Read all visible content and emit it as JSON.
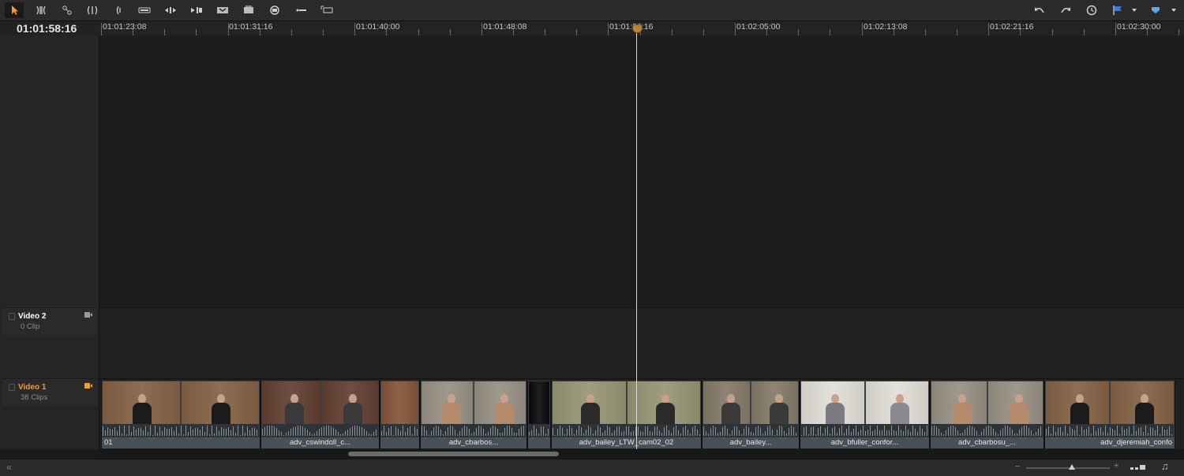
{
  "toolbar": {
    "tools": [
      {
        "name": "selection-mode",
        "icon": "arrow-pointer-icon",
        "active": true
      },
      {
        "name": "trim-edit-mode",
        "icon": "trim-icon"
      },
      {
        "name": "blade-edit-mode",
        "icon": "razor-icon"
      },
      {
        "name": "dynamic-trim-mode",
        "icon": "dynamic-trim-icon"
      },
      {
        "name": "snap-toggle",
        "icon": "bracket-icon"
      },
      {
        "name": "insert-clip",
        "icon": "insert-icon"
      },
      {
        "name": "overwrite-clip",
        "icon": "overwrite-icon"
      },
      {
        "name": "replace-clip",
        "icon": "replace-icon"
      },
      {
        "name": "fit-to-fill",
        "icon": "fit-to-fill-icon"
      },
      {
        "name": "place-on-top",
        "icon": "place-on-top-icon"
      },
      {
        "name": "ripple-overwrite",
        "icon": "ripple-icon"
      },
      {
        "name": "append-at-end",
        "icon": "append-icon"
      },
      {
        "name": "add-track",
        "icon": "add-track-icon"
      }
    ],
    "right_tools": [
      {
        "name": "undo",
        "icon": "undo-icon"
      },
      {
        "name": "redo",
        "icon": "redo-icon"
      },
      {
        "name": "history",
        "icon": "history-icon"
      },
      {
        "name": "flag",
        "icon": "flag-icon",
        "color": "#2f7de1"
      },
      {
        "name": "flag-dropdown",
        "icon": "chevron-down-icon"
      },
      {
        "name": "marker",
        "icon": "marker-icon",
        "color": "#5aa9f0"
      },
      {
        "name": "marker-dropdown",
        "icon": "chevron-down-icon"
      }
    ]
  },
  "timecode": "01:01:58:16",
  "ruler": {
    "labels": [
      "01:01:23:08",
      "01:01:31:16",
      "01:01:40:00",
      "01:01:48:08",
      "01:01:56:16",
      "01:02:05:00",
      "01:02:13:08",
      "01:02:21:16",
      "01:02:30:00"
    ]
  },
  "tracks": [
    {
      "name": "Video 2",
      "clips": "0 Clip",
      "active": false,
      "color": "#ffffff"
    },
    {
      "name": "Video 1",
      "clips": "38 Clips",
      "active": true,
      "color": "#ff9a1f"
    }
  ],
  "clips": [
    {
      "name": "01",
      "bg": "#7a5a3e",
      "people": [
        "#1b1b1b",
        "#1b1b1b"
      ],
      "align": "left"
    },
    {
      "name": "adv_cswindoll_c...",
      "bg": "#5a3a2c",
      "people": [
        "#3a3a3a",
        "#3a3a3a"
      ]
    },
    {
      "name": "",
      "bg": "#7a4e34",
      "people": []
    },
    {
      "name": "adv_cbarbos...",
      "bg": "#8a8578",
      "people": [
        "#b58a6a"
      ]
    },
    {
      "name": "",
      "bg": "#0a0a0a",
      "people": []
    },
    {
      "name": "adv_bailey_LTW_cam02_02",
      "bg": "#8a8a6a",
      "people": [
        "#2a2a2a",
        "#2a2a2a"
      ]
    },
    {
      "name": "adv_bailey...",
      "bg": "#7a7060",
      "people": [
        "#3a3a3a"
      ]
    },
    {
      "name": "adv_bfuller_confor...",
      "bg": "#cfcdc6",
      "people": [
        "#7a7a80",
        "#8a8a90"
      ]
    },
    {
      "name": "adv_cbarbosu_...",
      "bg": "#8a8578",
      "people": [
        "#b58a6a"
      ]
    },
    {
      "name": "adv_djeremiah_confo",
      "bg": "#7a5a3e",
      "people": [
        "#1b1b1b",
        "#1b1b1b"
      ],
      "align": "right"
    }
  ],
  "bottom": {
    "collapse_icon": "double-chevron-left-icon",
    "zoom_minus": "−",
    "zoom_plus": "+",
    "zoom_level": 0.55
  }
}
